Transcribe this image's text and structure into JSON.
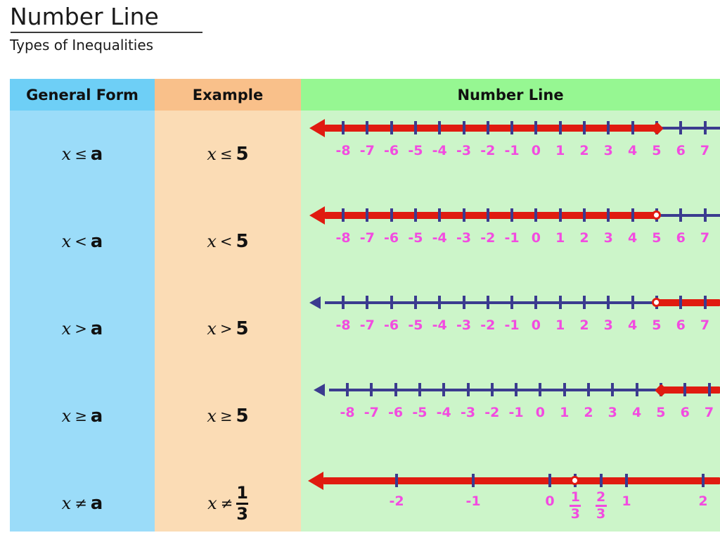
{
  "heading": {
    "title": "Number Line",
    "subtitle": "Types of Inequalities"
  },
  "table": {
    "headers": {
      "general_form": "General Form",
      "example": "Example",
      "number_line": "Number Line"
    },
    "header_colors": {
      "general_form": "#6ECFF6",
      "example": "#F9C08A",
      "number_line": "#96F792"
    },
    "body_colors": {
      "general_form": "#9BDCF9",
      "example": "#FBDCB5",
      "number_line": "#CCF5C9"
    },
    "rows": [
      {
        "general_form": {
          "var": "x",
          "op": "≤",
          "val": "a"
        },
        "example": {
          "var": "x",
          "op": "≤",
          "val": "5"
        },
        "number_line": {
          "boundary_value": 5,
          "boundary_marker": "closed-dot",
          "shaded_direction": "left",
          "arrow_color": "#E01B10",
          "labels": [
            "-8",
            "-7",
            "-6",
            "-5",
            "-4",
            "-3",
            "-2",
            "-1",
            "0",
            "1",
            "2",
            "3",
            "4",
            "5",
            "6",
            "7"
          ]
        }
      },
      {
        "general_form": {
          "var": "x",
          "op": "<",
          "val": "a"
        },
        "example": {
          "var": "x",
          "op": "<",
          "val": "5"
        },
        "number_line": {
          "boundary_value": 5,
          "boundary_marker": "open-circle",
          "shaded_direction": "left",
          "arrow_color": "#E01B10",
          "labels": [
            "-8",
            "-7",
            "-6",
            "-5",
            "-4",
            "-3",
            "-2",
            "-1",
            "0",
            "1",
            "2",
            "3",
            "4",
            "5",
            "6",
            "7"
          ]
        }
      },
      {
        "general_form": {
          "var": "x",
          "op": ">",
          "val": "a"
        },
        "example": {
          "var": "x",
          "op": ">",
          "val": "5"
        },
        "number_line": {
          "boundary_value": 5,
          "boundary_marker": "open-circle",
          "shaded_direction": "right",
          "arrow_color": "#3B3B8F",
          "labels": [
            "-8",
            "-7",
            "-6",
            "-5",
            "-4",
            "-3",
            "-2",
            "-1",
            "0",
            "1",
            "2",
            "3",
            "4",
            "5",
            "6",
            "7"
          ]
        }
      },
      {
        "general_form": {
          "var": "x",
          "op": "≥",
          "val": "a"
        },
        "example": {
          "var": "x",
          "op": "≥",
          "val": "5"
        },
        "number_line": {
          "boundary_value": 5,
          "boundary_marker": "closed-dot",
          "shaded_direction": "right",
          "arrow_color": "#3B3B8F",
          "labels": [
            "-8",
            "-7",
            "-6",
            "-5",
            "-4",
            "-3",
            "-2",
            "-1",
            "0",
            "1",
            "2",
            "3",
            "4",
            "5",
            "6",
            "7"
          ]
        }
      },
      {
        "general_form": {
          "var": "x",
          "op": "≠",
          "val": "a"
        },
        "example": {
          "var": "x",
          "op": "≠",
          "num": "1",
          "den": "3"
        },
        "number_line": {
          "boundary_value": "1/3",
          "boundary_marker": "open-circle",
          "shaded_direction": "both",
          "arrow_color": "#E01B10",
          "labels": [
            "-2",
            "-1",
            "0",
            "1/3",
            "2/3",
            "1",
            "2"
          ]
        }
      }
    ]
  },
  "chart_data": {
    "type": "number-line-diagram",
    "title": "Number Line",
    "subtitle": "Types of Inequalities",
    "colors": {
      "shaded_segment": "#E01B10",
      "unshaded_axis": "#3B3B8F",
      "tick": "#3B3B8F",
      "label": "#F24BE0"
    },
    "lines": [
      {
        "inequality": "x ≤ 5",
        "general": "x ≤ a",
        "axis_min": -8,
        "axis_max": 7,
        "ticks": [
          -8,
          -7,
          -6,
          -5,
          -4,
          -3,
          -2,
          -1,
          0,
          1,
          2,
          3,
          4,
          5,
          6,
          7
        ],
        "tick_labels": [
          "-8",
          "-7",
          "-6",
          "-5",
          "-4",
          "-3",
          "-2",
          "-1",
          "0",
          "1",
          "2",
          "3",
          "4",
          "5",
          "6",
          "7"
        ],
        "boundary": 5,
        "marker": "closed",
        "solution": "(-inf, 5]",
        "direction": "left"
      },
      {
        "inequality": "x < 5",
        "general": "x < a",
        "axis_min": -8,
        "axis_max": 7,
        "ticks": [
          -8,
          -7,
          -6,
          -5,
          -4,
          -3,
          -2,
          -1,
          0,
          1,
          2,
          3,
          4,
          5,
          6,
          7
        ],
        "tick_labels": [
          "-8",
          "-7",
          "-6",
          "-5",
          "-4",
          "-3",
          "-2",
          "-1",
          "0",
          "1",
          "2",
          "3",
          "4",
          "5",
          "6",
          "7"
        ],
        "boundary": 5,
        "marker": "open",
        "solution": "(-inf, 5)",
        "direction": "left"
      },
      {
        "inequality": "x > 5",
        "general": "x > a",
        "axis_min": -8,
        "axis_max": 7,
        "ticks": [
          -8,
          -7,
          -6,
          -5,
          -4,
          -3,
          -2,
          -1,
          0,
          1,
          2,
          3,
          4,
          5,
          6,
          7
        ],
        "tick_labels": [
          "-8",
          "-7",
          "-6",
          "-5",
          "-4",
          "-3",
          "-2",
          "-1",
          "0",
          "1",
          "2",
          "3",
          "4",
          "5",
          "6",
          "7"
        ],
        "boundary": 5,
        "marker": "open",
        "solution": "(5, inf)",
        "direction": "right"
      },
      {
        "inequality": "x ≥ 5",
        "general": "x ≥ a",
        "axis_min": -8,
        "axis_max": 7,
        "ticks": [
          -8,
          -7,
          -6,
          -5,
          -4,
          -3,
          -2,
          -1,
          0,
          1,
          2,
          3,
          4,
          5,
          6,
          7
        ],
        "tick_labels": [
          "-8",
          "-7",
          "-6",
          "-5",
          "-4",
          "-3",
          "-2",
          "-1",
          "0",
          "1",
          "2",
          "3",
          "4",
          "5",
          "6",
          "7"
        ],
        "boundary": 5,
        "marker": "closed",
        "solution": "[5, inf)",
        "direction": "right"
      },
      {
        "inequality": "x ≠ 1/3",
        "general": "x ≠ a",
        "axis_min": -2.6,
        "axis_max": 2.6,
        "ticks": [
          -2,
          -1,
          0,
          0.3333,
          0.6667,
          1,
          2
        ],
        "tick_labels": [
          "-2",
          "-1",
          "0",
          "1/3",
          "2/3",
          "1",
          "2"
        ],
        "boundary": 0.3333,
        "marker": "open",
        "solution": "all reals except 1/3",
        "direction": "both"
      }
    ]
  }
}
